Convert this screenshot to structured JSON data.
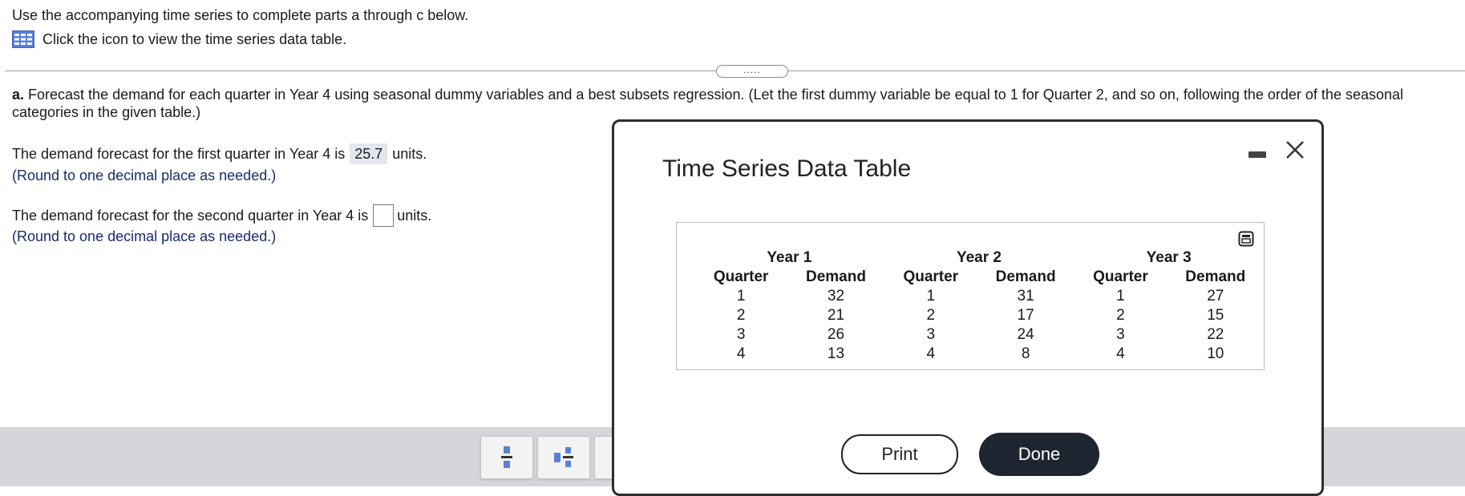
{
  "intro": {
    "line1": "Use the accompanying time series to complete parts a through c below.",
    "line2": "Click the icon to view the time series data table."
  },
  "expander": {
    "label": "....."
  },
  "partA": {
    "label": "a.",
    "text": "Forecast the demand for each quarter in Year 4 using seasonal dummy variables and a best subsets regression. (Let the first dummy variable be equal to 1 for Quarter 2, and so on, following the order of the seasonal categories in the given table.)"
  },
  "q1": {
    "prefix": "The demand forecast for the first quarter in Year 4 is",
    "value": "25.7",
    "suffix": "units.",
    "hint": "(Round to one decimal place as needed.)"
  },
  "q2": {
    "prefix": "The demand forecast for the second quarter in Year 4 is",
    "value": "",
    "suffix": "units.",
    "hint": "(Round to one decimal place as needed.)"
  },
  "dialog": {
    "title": "Time Series Data Table",
    "years": [
      "Year 1",
      "Year 2",
      "Year 3"
    ],
    "col_quarter": "Quarter",
    "col_demand": "Demand",
    "rows": [
      {
        "q1": "1",
        "d1": "32",
        "q2": "1",
        "d2": "31",
        "q3": "1",
        "d3": "27"
      },
      {
        "q1": "2",
        "d1": "21",
        "q2": "2",
        "d2": "17",
        "q3": "2",
        "d3": "15"
      },
      {
        "q1": "3",
        "d1": "26",
        "q2": "3",
        "d2": "24",
        "q3": "3",
        "d3": "22"
      },
      {
        "q1": "4",
        "d1": "13",
        "q2": "4",
        "d2": "8",
        "q3": "4",
        "d3": "10"
      }
    ],
    "print_label": "Print",
    "done_label": "Done"
  },
  "icons": {
    "table": "table-icon",
    "popout": "popout-icon",
    "minimize": "minimize-icon",
    "close": "close-icon",
    "fraction": "fraction-icon",
    "mixed_number": "mixed-number-icon"
  },
  "colors": {
    "hint_text": "#1b2a6b",
    "filled_answer_bg": "#e4e7ef",
    "done_button_bg": "#1e2530",
    "toolbar_bg": "#d4d6da",
    "icon_blue": "#5b7fd6"
  }
}
